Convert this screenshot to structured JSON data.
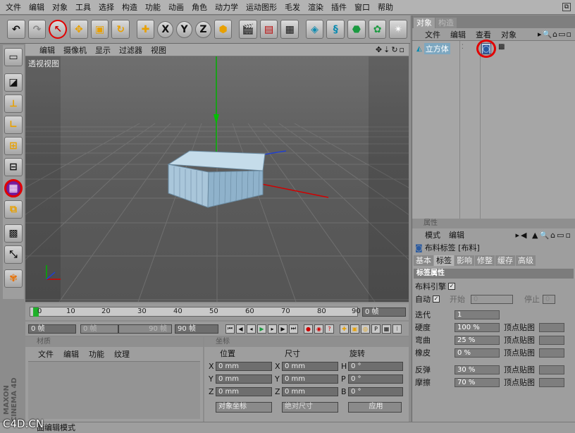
{
  "menu": [
    "文件",
    "编辑",
    "对象",
    "工具",
    "选择",
    "构造",
    "功能",
    "动画",
    "角色",
    "动力学",
    "运动图形",
    "毛发",
    "渲染",
    "插件",
    "窗口",
    "帮助"
  ],
  "toolbar_icons": [
    "undo-icon",
    "redo-icon",
    "live-select-icon",
    "move-icon",
    "scale-icon",
    "rotate-icon",
    "move-icon",
    "x-axis-icon",
    "y-axis-icon",
    "z-axis-icon",
    "coordinate-system-icon",
    "render-view-icon",
    "render-picture-viewer-icon",
    "render-settings-icon",
    "cube-icon",
    "spline-icon",
    "nurbs-icon",
    "array-icon",
    "deformer-icon"
  ],
  "toolbar_axes": [
    "X",
    "Y",
    "Z"
  ],
  "viewport": {
    "menu": [
      "编辑",
      "摄像机",
      "显示",
      "过滤器",
      "视图"
    ],
    "label": "透视视图"
  },
  "timeline": {
    "ticks": [
      "0",
      "10",
      "20",
      "30",
      "40",
      "50",
      "60",
      "70",
      "80",
      "90"
    ],
    "current_frame": "0 帧",
    "start_frame": "0 帧",
    "min_field": "0 帧",
    "max_field": "90 帧",
    "end_frame": "90 帧"
  },
  "materials": {
    "title": "材质",
    "menu": [
      "文件",
      "编辑",
      "功能",
      "纹理"
    ]
  },
  "coords": {
    "title": "坐标",
    "headers": [
      "位置",
      "尺寸",
      "旋转"
    ],
    "rows": [
      {
        "axis": "X",
        "pos": "0 mm",
        "size_axis": "X",
        "size": "0 mm",
        "rot_axis": "H",
        "rot": "0 °"
      },
      {
        "axis": "Y",
        "pos": "0 mm",
        "size_axis": "Y",
        "size": "0 mm",
        "rot_axis": "P",
        "rot": "0 °"
      },
      {
        "axis": "Z",
        "pos": "0 mm",
        "size_axis": "Z",
        "size": "0 mm",
        "rot_axis": "B",
        "rot": "0 °"
      }
    ],
    "mode_select": "对象坐标",
    "size_select": "绝对尺寸",
    "apply": "应用"
  },
  "status": "面编辑模式",
  "watermark": "C4D.CN",
  "brand_vertical": "MAXON CINEMA 4D",
  "objects_panel": {
    "tabs": [
      "对象",
      "构造"
    ],
    "menu": [
      "文件",
      "编辑",
      "查看",
      "对象"
    ],
    "object_name": "立方体"
  },
  "attributes_panel": {
    "title": "属性",
    "menu": [
      "模式",
      "编辑"
    ],
    "tag_title": "布料标签 [布料]",
    "subtabs": [
      "基本",
      "标签",
      "影响",
      "修整",
      "缓存",
      "高级"
    ],
    "section": "标签属性",
    "cloth_engine": "布料引擎",
    "auto": "自动",
    "start": "开始",
    "start_val": "0",
    "stop": "停止",
    "stop_val": "0",
    "params": [
      {
        "label": "迭代",
        "value": "1",
        "map": ""
      },
      {
        "label": "硬度",
        "value": "100 %",
        "map": "顶点贴图"
      },
      {
        "label": "弯曲",
        "value": "25 %",
        "map": "顶点贴图"
      },
      {
        "label": "橡皮",
        "value": "0 %",
        "map": "顶点贴图"
      },
      {
        "label": "反弹",
        "value": "30 %",
        "map": "顶点贴图"
      },
      {
        "label": "摩擦",
        "value": "70 %",
        "map": "顶点贴图"
      }
    ]
  },
  "colors": {
    "highlight_circle": "#e10000",
    "axis_x": "#d00000",
    "axis_y": "#00b000",
    "axis_z": "#2040d0",
    "cube": "#a9cde6"
  }
}
